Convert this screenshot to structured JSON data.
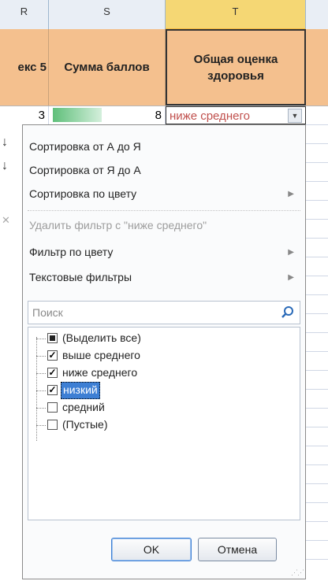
{
  "columns": {
    "r": "R",
    "s": "S",
    "t": "T"
  },
  "header_row": {
    "col_r": "екс 5",
    "col_s": "Сумма баллов",
    "col_t": "Общая оценка здоровья"
  },
  "data_row": {
    "col_r_value": "3",
    "col_s_value": "8",
    "col_t_value": "ниже среднего"
  },
  "menu": {
    "sort_az": "Сортировка от А до Я",
    "sort_za": "Сортировка от Я до А",
    "sort_by_color": "Сортировка по цвету",
    "clear_filter": "Удалить фильтр с \"ниже среднего\"",
    "filter_by_color": "Фильтр по цвету",
    "text_filters": "Текстовые фильтры"
  },
  "search": {
    "placeholder": "Поиск"
  },
  "filter_list": [
    {
      "label": "(Выделить все)",
      "state": "partial"
    },
    {
      "label": "выше среднего",
      "state": "checked"
    },
    {
      "label": "ниже среднего",
      "state": "checked"
    },
    {
      "label": "низкий",
      "state": "checked",
      "highlighted": true
    },
    {
      "label": "средний",
      "state": "unchecked"
    },
    {
      "label": "(Пустые)",
      "state": "unchecked"
    }
  ],
  "buttons": {
    "ok": "OK",
    "cancel": "Отмена"
  },
  "colors": {
    "header_fill": "#f4c08e",
    "selection_blue": "#3d7fd4",
    "value_text": "#c0504d",
    "databar_green": "#5fbf7a"
  },
  "icons": [
    "sort-az-icon",
    "sort-za-icon",
    "clear-filter-icon",
    "search-icon",
    "submenu-arrow-icon",
    "dropdown-arrow-icon"
  ]
}
